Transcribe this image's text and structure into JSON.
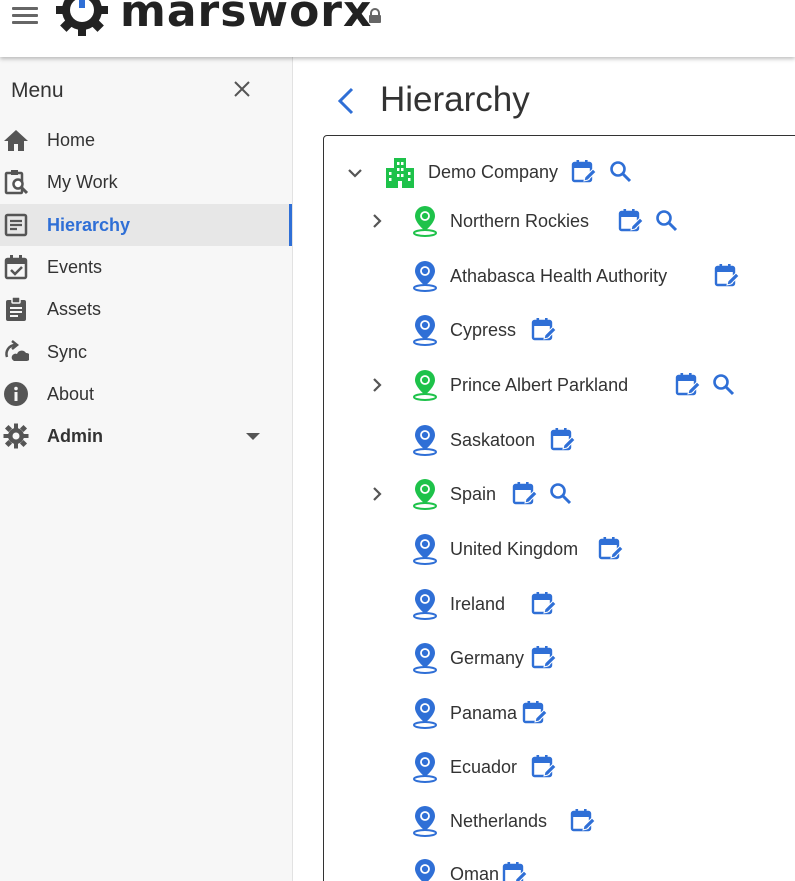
{
  "app": {
    "logo_text": "marsworx",
    "brand_color": "#2f6fd6"
  },
  "sidebar": {
    "title": "Menu",
    "items": [
      {
        "label": "Home",
        "icon": "home-icon"
      },
      {
        "label": "My Work",
        "icon": "clipboard-search-icon"
      },
      {
        "label": "Hierarchy",
        "icon": "hierarchy-icon",
        "active": true
      },
      {
        "label": "Events",
        "icon": "calendar-check-icon"
      },
      {
        "label": "Assets",
        "icon": "clipboard-list-icon"
      },
      {
        "label": "Sync",
        "icon": "sync-icon"
      },
      {
        "label": "About",
        "icon": "info-icon"
      },
      {
        "label": "Admin",
        "icon": "gear-icon",
        "expandable": true
      }
    ]
  },
  "main": {
    "title": "Hierarchy",
    "tree": {
      "root": {
        "label": "Demo Company",
        "icon": "building-icon",
        "expanded": true
      },
      "children": [
        {
          "label": "Northern Rockies",
          "icon": "location-pin-icon",
          "status": "green",
          "expandable": true,
          "search": true
        },
        {
          "label": "Athabasca Health Authority",
          "icon": "location-pin-icon",
          "status": "blue"
        },
        {
          "label": "Cypress",
          "icon": "location-pin-icon",
          "status": "blue"
        },
        {
          "label": "Prince Albert Parkland",
          "icon": "location-pin-icon",
          "status": "green",
          "expandable": true,
          "search": true
        },
        {
          "label": "Saskatoon",
          "icon": "location-pin-icon",
          "status": "blue"
        },
        {
          "label": "Spain",
          "icon": "location-pin-icon",
          "status": "green",
          "expandable": true,
          "search": true
        },
        {
          "label": "United Kingdom",
          "icon": "location-pin-icon",
          "status": "blue"
        },
        {
          "label": "Ireland",
          "icon": "location-pin-icon",
          "status": "blue"
        },
        {
          "label": "Germany",
          "icon": "location-pin-icon",
          "status": "blue"
        },
        {
          "label": "Panama",
          "icon": "location-pin-icon",
          "status": "blue"
        },
        {
          "label": "Ecuador",
          "icon": "location-pin-icon",
          "status": "blue"
        },
        {
          "label": "Netherlands",
          "icon": "location-pin-icon",
          "status": "blue"
        },
        {
          "label": "Oman",
          "icon": "location-pin-icon",
          "status": "blue"
        }
      ]
    }
  },
  "colors": {
    "green": "#1ec24a",
    "blue": "#2f6fd6",
    "text": "#333333"
  }
}
